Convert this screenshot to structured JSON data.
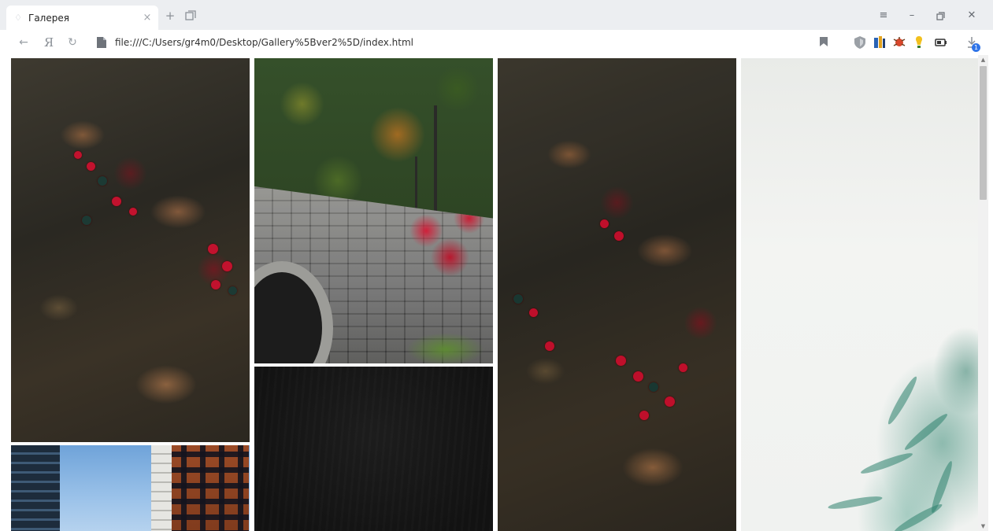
{
  "tab": {
    "title": "Галерея"
  },
  "address": {
    "url": "file:///C:/Users/gr4m0/Desktop/Gallery%5Bver2%5D/index.html"
  },
  "nav": {
    "logo": "Я"
  },
  "downloads": {
    "badge": "1"
  },
  "gallery": {
    "photos": [
      {
        "subject": "dark leaves with red berries",
        "column": 1
      },
      {
        "subject": "city buildings under blue sky",
        "column": 1
      },
      {
        "subject": "ivy over stone bridge with red leaves",
        "column": 2
      },
      {
        "subject": "dark textured board",
        "column": 2
      },
      {
        "subject": "leaves and red berries close-up",
        "column": 3
      },
      {
        "subject": "misty fern leaves",
        "column": 4
      }
    ]
  },
  "colors": {
    "tabbar_bg": "#eceef1",
    "scroll_thumb": "#c1c1c1"
  }
}
